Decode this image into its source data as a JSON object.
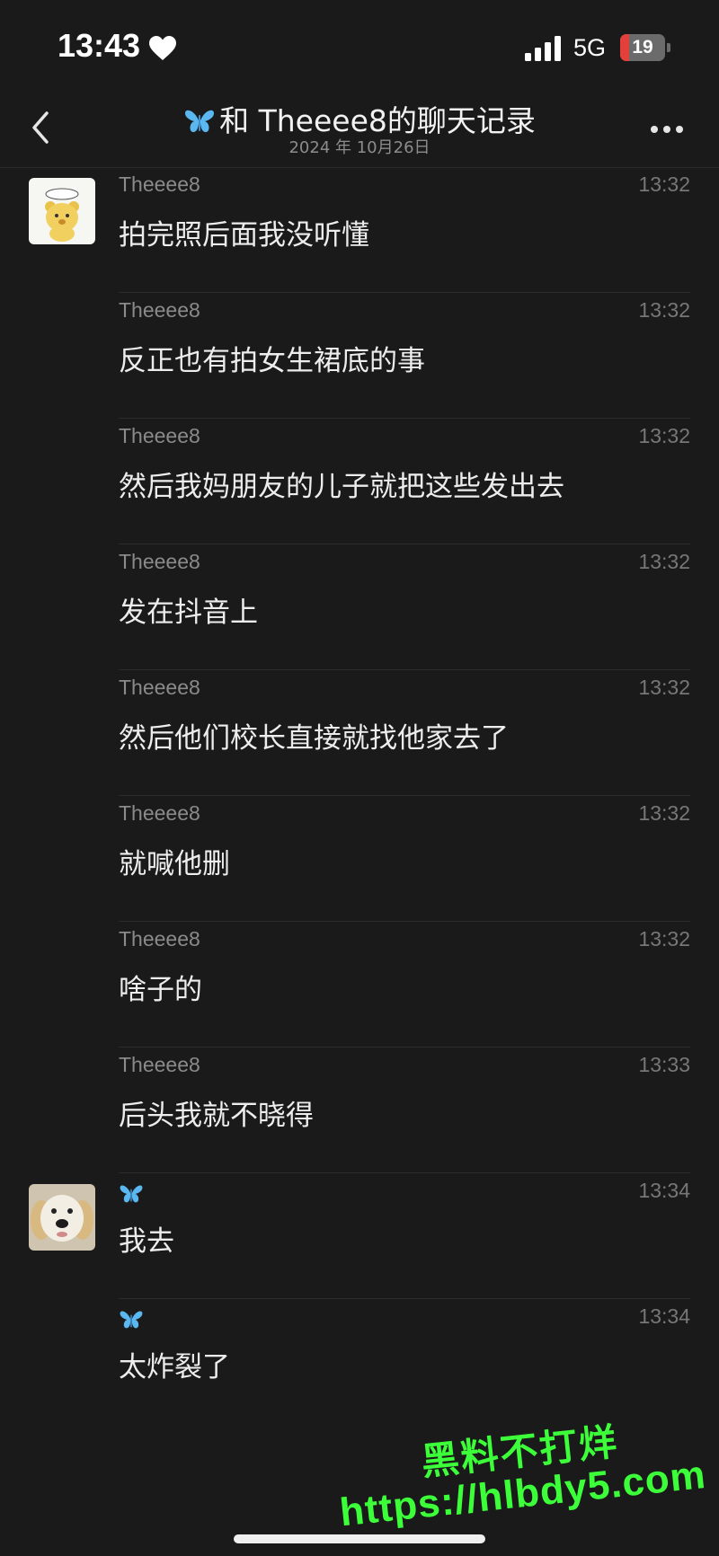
{
  "status_bar": {
    "time": "13:43",
    "network": "5G",
    "battery_level": "19",
    "battery_fraction": 0.19
  },
  "nav": {
    "title": "和 Theeee8的聊天记录",
    "date": "2024 年 10月26日"
  },
  "messages": [
    {
      "sender": "Theeee8",
      "time": "13:32",
      "text": "拍完照后面我没听懂",
      "avatar": "bear-avatar"
    },
    {
      "sender": "Theeee8",
      "time": "13:32",
      "text": "反正也有拍女生裙底的事"
    },
    {
      "sender": "Theeee8",
      "time": "13:32",
      "text": "然后我妈朋友的儿子就把这些发出去"
    },
    {
      "sender": "Theeee8",
      "time": "13:32",
      "text": "发在抖音上"
    },
    {
      "sender": "Theeee8",
      "time": "13:32",
      "text": "然后他们校长直接就找他家去了"
    },
    {
      "sender": "Theeee8",
      "time": "13:32",
      "text": "就喊他删"
    },
    {
      "sender": "Theeee8",
      "time": "13:32",
      "text": "啥子的"
    },
    {
      "sender": "Theeee8",
      "time": "13:33",
      "text": "后头我就不晓得"
    },
    {
      "sender": "butterfly-icon",
      "time": "13:34",
      "text": "我去",
      "avatar": "dog-avatar"
    },
    {
      "sender": "butterfly-icon",
      "time": "13:34",
      "text": "太炸裂了"
    }
  ],
  "watermark": {
    "line1": "黑料不打烊",
    "line2": "https://hlbdy5.com"
  },
  "colors": {
    "background": "#1a1a1a",
    "butterfly": "#5bb7f0",
    "watermark": "#3cff3a",
    "battery": "#e3403b"
  }
}
